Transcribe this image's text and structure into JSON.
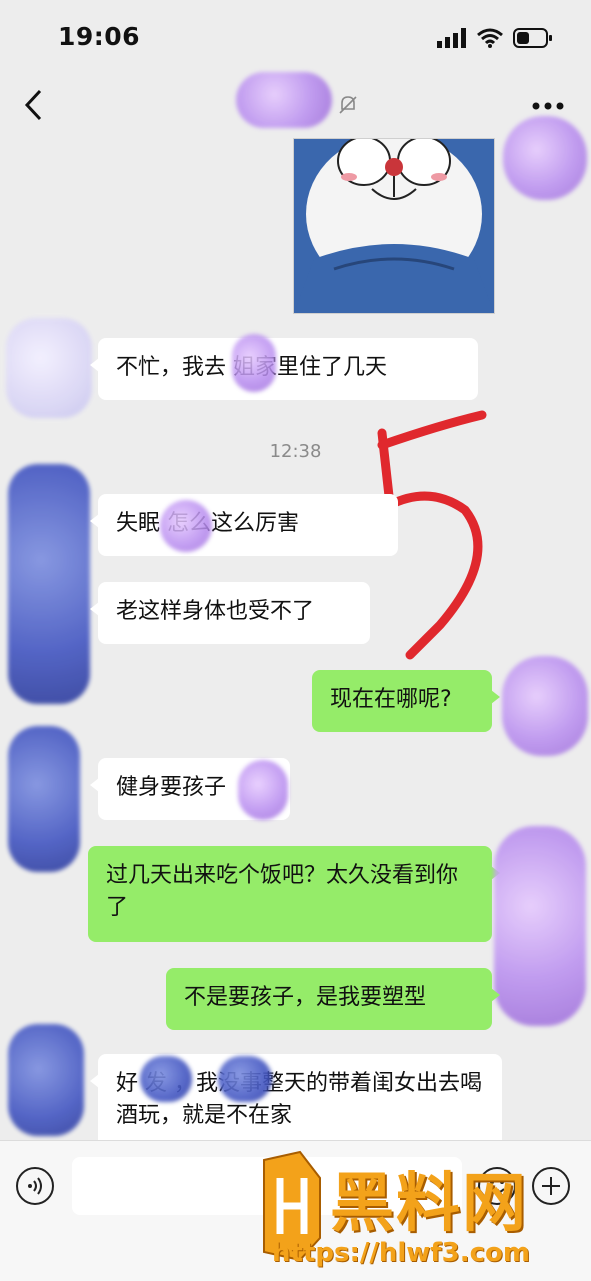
{
  "status_bar": {
    "time": "19:06"
  },
  "messages": [
    {
      "side": "left",
      "text": "不忙，我去    姐家里住了几天"
    },
    {
      "side": "left",
      "text": "失眠       怎么这么厉害"
    },
    {
      "side": "left",
      "text": "老这样身体也受不了"
    },
    {
      "side": "right",
      "text": "现在在哪呢?"
    },
    {
      "side": "left",
      "text": "健身要孩子"
    },
    {
      "side": "right",
      "text": "过几天出来吃个饭吧？太久没看到你了"
    },
    {
      "side": "right",
      "text": "不是要孩子，是我要塑型"
    },
    {
      "side": "left",
      "text": "好    发      ，我没事整天的带着闺女出去喝酒玩，就是不在家"
    }
  ],
  "timestamp": "12:38",
  "annotation": {
    "text": "5",
    "color": "#e0282d"
  },
  "watermark": {
    "name": "黑料网",
    "url": "https://hlwf3.com",
    "color": "#f3a21a"
  },
  "colors": {
    "background": "#ededed",
    "bubble_left": "#ffffff",
    "bubble_right": "#95ec69"
  }
}
